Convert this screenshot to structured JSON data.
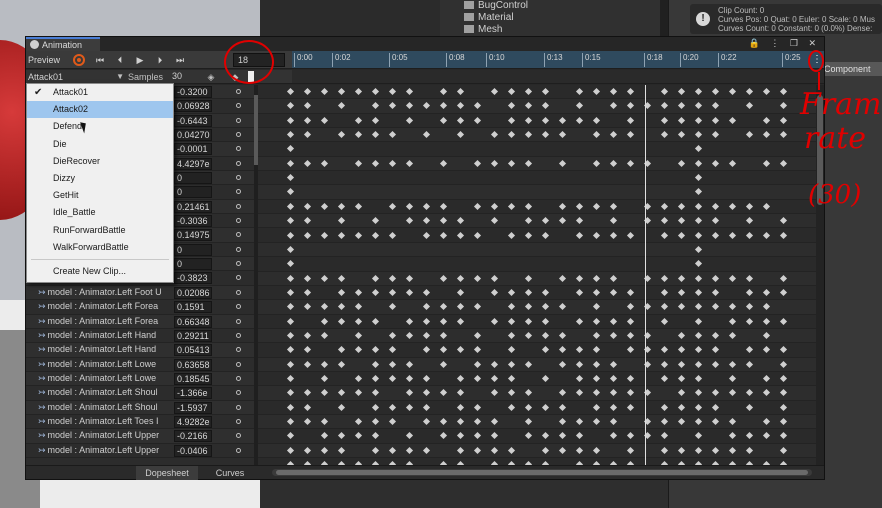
{
  "background": {
    "hierarchy_items": [
      "BugControl",
      "Material",
      "Mesh"
    ],
    "inspector_info": [
      "Clip Count: 0",
      "Curves Pos: 0 Quat: 0 Euler: 0 Scale: 0 Mus",
      "Curves Count: 0 Constant: 0 (0.0%) Dense:"
    ],
    "inspector_button": "Component"
  },
  "window": {
    "tab_label": "Animation",
    "title_icons": "🔒 ⋮ ❐ ✕"
  },
  "toolbar": {
    "preview_label": "Preview",
    "first_key_icon": "⏮",
    "prev_key_icon": "⏴",
    "play_icon": "▶",
    "next_key_icon": "⏵",
    "last_key_icon": "⏭",
    "frame_value": "18"
  },
  "ruler": {
    "ticks": [
      "0:00",
      "0:02",
      "0:05",
      "0:08",
      "0:10",
      "0:13",
      "0:15",
      "0:18",
      "0:20",
      "0:22",
      "0:25"
    ],
    "menu_icon": "⋮"
  },
  "clipbar": {
    "clip_name": "Attack01",
    "samples_label": "Samples",
    "samples_value": "30",
    "key_icon": "◈",
    "addkey_icon": "◆"
  },
  "properties": [
    {
      "name": "",
      "value": "-0.3200"
    },
    {
      "name": "",
      "value": "0.06928"
    },
    {
      "name": "",
      "value": "-0.6443"
    },
    {
      "name": "",
      "value": "0.04270"
    },
    {
      "name": "",
      "value": "-0.0001"
    },
    {
      "name": "",
      "value": "4.4297e"
    },
    {
      "name": "",
      "value": "0"
    },
    {
      "name": "",
      "value": "0"
    },
    {
      "name": "",
      "value": "0.21461"
    },
    {
      "name": "",
      "value": "-0.3036"
    },
    {
      "name": "",
      "value": "0.14975"
    },
    {
      "name": "",
      "value": "0"
    },
    {
      "name": "",
      "value": "0"
    },
    {
      "name": "model : Animator.Left Foot T",
      "value": "-0.3823"
    },
    {
      "name": "model : Animator.Left Foot U",
      "value": "0.02086"
    },
    {
      "name": "model : Animator.Left Forea",
      "value": "0.1591"
    },
    {
      "name": "model : Animator.Left Forea",
      "value": "0.66348"
    },
    {
      "name": "model : Animator.Left Hand",
      "value": "0.29211"
    },
    {
      "name": "model : Animator.Left Hand",
      "value": "0.05413"
    },
    {
      "name": "model : Animator.Left Lowe",
      "value": "0.63658"
    },
    {
      "name": "model : Animator.Left Lowe",
      "value": "0.18545"
    },
    {
      "name": "model : Animator.Left Shoul",
      "value": "-1.366e"
    },
    {
      "name": "model : Animator.Left Shoul",
      "value": "-1.5937"
    },
    {
      "name": "model : Animator.Left Toes I",
      "value": "4.9282e"
    },
    {
      "name": "model : Animator.Left Upper",
      "value": "-0.2166"
    },
    {
      "name": "model : Animator.Left Upper",
      "value": "-0.0406"
    }
  ],
  "dropdown": {
    "items": [
      {
        "label": "Attack01",
        "checked": true,
        "hover": false
      },
      {
        "label": "Attack02",
        "checked": false,
        "hover": true
      },
      {
        "label": "Defend",
        "checked": false,
        "hover": false
      },
      {
        "label": "Die",
        "checked": false,
        "hover": false
      },
      {
        "label": "DieRecover",
        "checked": false,
        "hover": false
      },
      {
        "label": "Dizzy",
        "checked": false,
        "hover": false
      },
      {
        "label": "GetHit",
        "checked": false,
        "hover": false
      },
      {
        "label": "Idle_Battle",
        "checked": false,
        "hover": false
      },
      {
        "label": "RunForwardBattle",
        "checked": false,
        "hover": false
      },
      {
        "label": "WalkForwardBattle",
        "checked": false,
        "hover": false
      }
    ],
    "create_label": "Create New Clip...",
    "check_icon": "✔"
  },
  "bottom_tabs": {
    "dopesheet": "Dopesheet",
    "curves": "Curves"
  },
  "annotation": {
    "text_line1": "Frame",
    "text_line2": "rate",
    "text_line3": "(30)",
    "color": "#e00000"
  }
}
